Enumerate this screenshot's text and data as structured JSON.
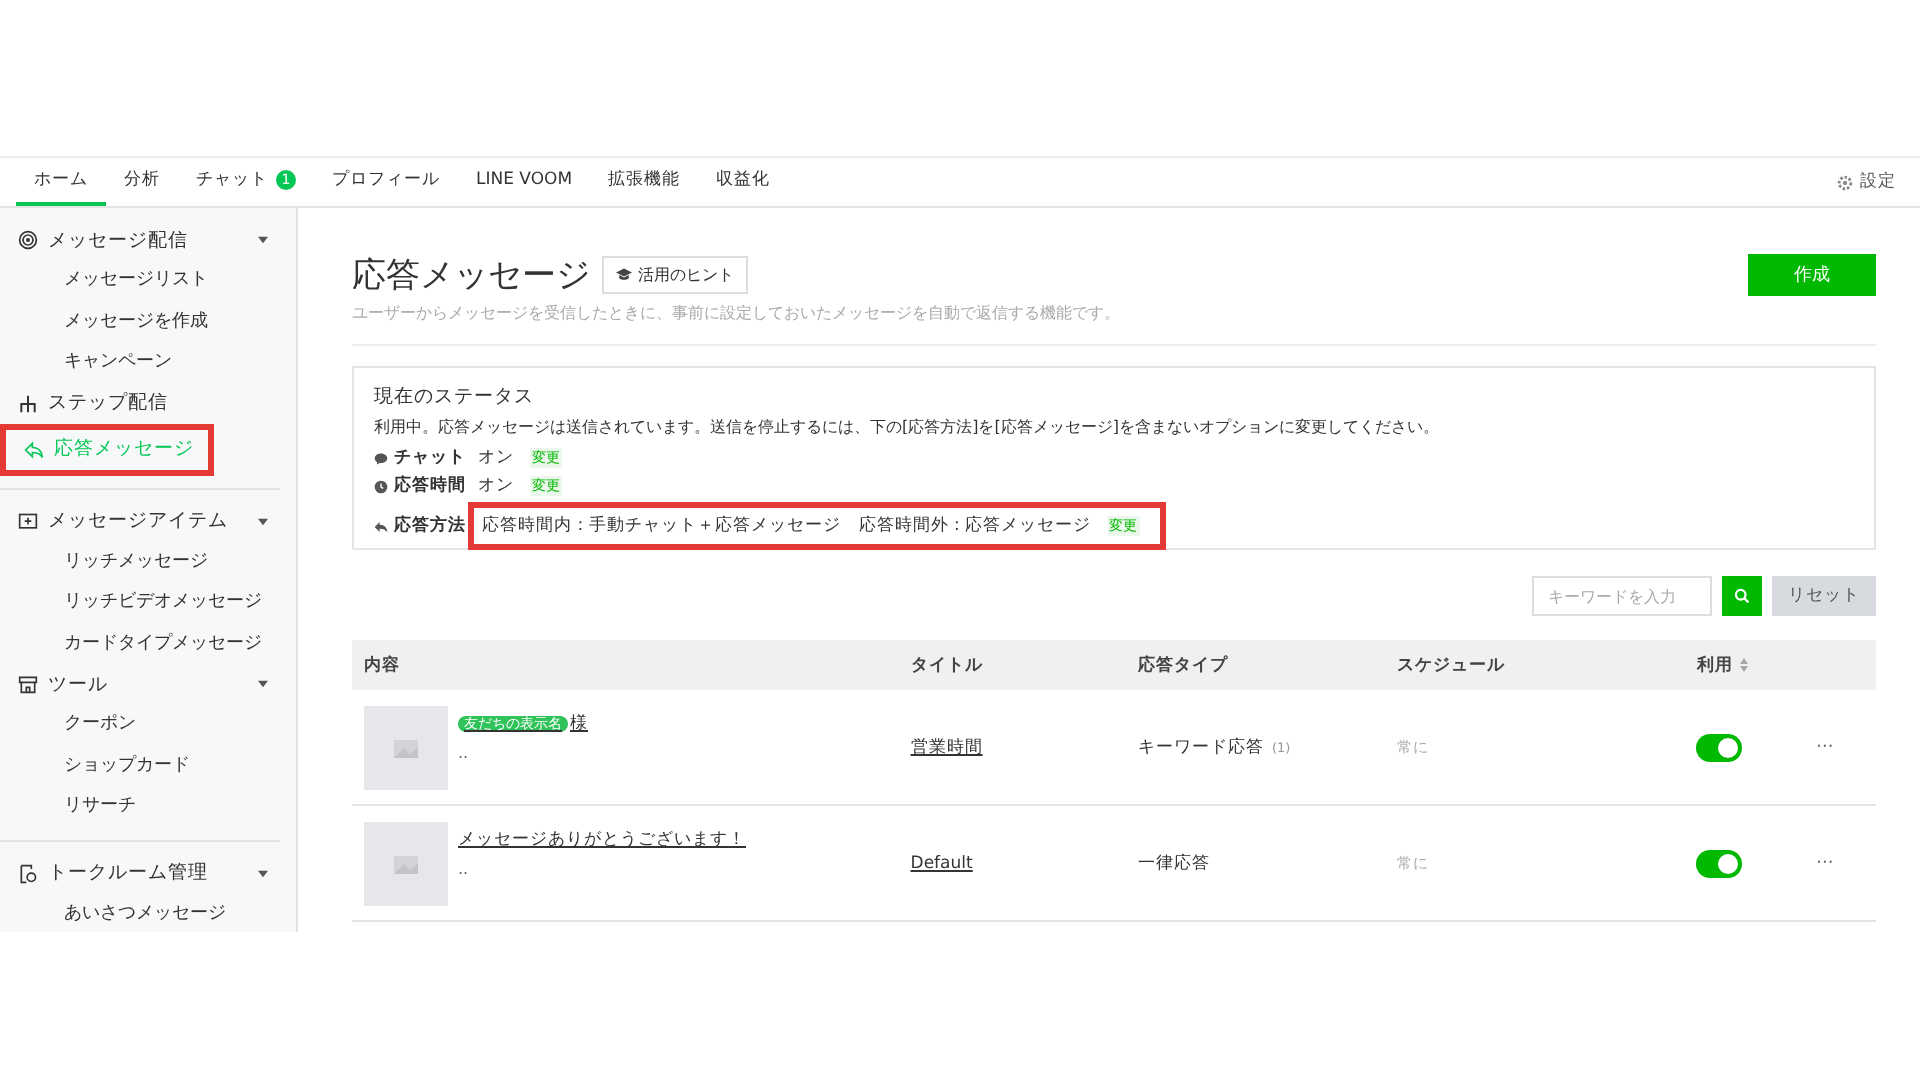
{
  "nav": {
    "tabs": [
      {
        "label": "ホーム",
        "selected": true
      },
      {
        "label": "分析",
        "selected": false
      },
      {
        "label": "チャット",
        "selected": false,
        "badge": "1"
      },
      {
        "label": "プロフィール",
        "selected": false
      },
      {
        "label": "LINE VOOM",
        "selected": false
      },
      {
        "label": "拡張機能",
        "selected": false
      },
      {
        "label": "収益化",
        "selected": false
      }
    ],
    "settings": "設定"
  },
  "sidebar": {
    "groups": [
      [
        {
          "label": "メッセージ配信",
          "kind": "broadcast",
          "selected": false,
          "highlighted": false,
          "children": [
            {
              "label": "メッセージリスト"
            },
            {
              "label": "メッセージを作成"
            },
            {
              "label": "キャンペーン"
            }
          ]
        },
        {
          "label": "ステップ配信",
          "kind": "step",
          "selected": false,
          "highlighted": false
        },
        {
          "label": "応答メッセージ",
          "kind": "reply",
          "selected": true,
          "highlighted": true
        }
      ],
      [
        {
          "label": "メッセージアイテム",
          "kind": "item",
          "selected": false,
          "highlighted": false,
          "children": [
            {
              "label": "リッチメッセージ"
            },
            {
              "label": "リッチビデオメッセージ"
            },
            {
              "label": "カードタイプメッセージ"
            }
          ]
        },
        {
          "label": "ツール",
          "kind": "tool",
          "selected": false,
          "highlighted": false,
          "children": [
            {
              "label": "クーポン"
            },
            {
              "label": "ショップカード"
            },
            {
              "label": "リサーチ"
            }
          ]
        }
      ],
      [
        {
          "label": "トークルーム管理",
          "kind": "chatroom",
          "selected": false,
          "highlighted": false,
          "children": [
            {
              "label": "あいさつメッセージ"
            }
          ]
        }
      ]
    ]
  },
  "page": {
    "title": "応答メッセージ",
    "hint_button": "活用のヒント",
    "create_button": "作成",
    "description": "ユーザーからメッセージを受信したときに、事前に設定しておいたメッセージを自動で返信する機能です。"
  },
  "status": {
    "heading": "現在のステータス",
    "message": "利用中。応答メッセージは送信されています。送信を停止するには、下の[応答方法]を[応答メッセージ]を含まないオプションに変更してください。",
    "rows": [
      {
        "kind": "chat",
        "label": "チャット",
        "value": "オン",
        "link": "変更",
        "highlighted": false
      },
      {
        "kind": "clock",
        "label": "応答時間",
        "value": "オン",
        "link": "変更",
        "highlighted": false
      },
      {
        "kind": "reply",
        "label": "応答方法",
        "value": "応答時間内 : 手動チャット＋応答メッセージ　応答時間外 : 応答メッセージ",
        "link": "変更",
        "highlighted": true
      }
    ]
  },
  "search": {
    "placeholder": "キーワードを入力",
    "reset_button": "リセット"
  },
  "table": {
    "columns": [
      "内容",
      "タイトル",
      "応答タイプ",
      "スケジュール",
      "利用"
    ],
    "rows": [
      {
        "tag": "友だちの表示名",
        "text": "様",
        "sub": "..",
        "title": "営業時間",
        "type": "キーワード応答",
        "type_count": "(1)",
        "schedule": "常に",
        "enabled": true,
        "more": "···"
      },
      {
        "text": "メッセージありがとうございます！",
        "sub": "..",
        "title": "Default",
        "type": "一律応答",
        "schedule": "常に",
        "enabled": true,
        "more": "···"
      }
    ]
  }
}
